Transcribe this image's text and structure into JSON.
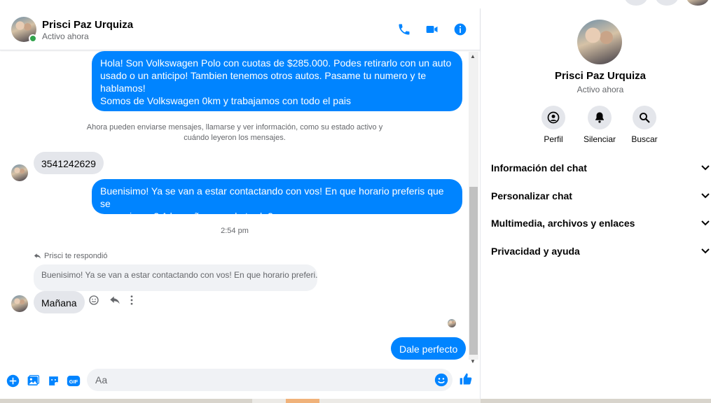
{
  "header": {
    "contact_name": "Prisci Paz Urquiza",
    "status": "Activo ahora",
    "icons": [
      "phone-icon",
      "video-camera-icon",
      "info-icon"
    ]
  },
  "messages": {
    "outgoing_1": "Hola! Son Volkswagen Polo con cuotas de $285.000. Podes retirarlo con un auto\nusado o un anticipo! Tambien tenemos otros autos. Pasame tu numero y te\nhablamos!\nSomos de Volkswagen 0km y trabajamos con todo el pais",
    "system_notice": "Ahora pueden enviarse mensajes, llamarse y ver información, como su estado activo y cuándo leyeron los mensajes.",
    "incoming_1": "3541242629",
    "outgoing_2": "Buenisimo! Ya se van a estar contactando con vos! En que horario preferis que se\ncomuniquen? A la mañana o a la tarde?",
    "timestamp": "2:54 pm",
    "reply_label": "Prisci te respondió",
    "quoted_text": "Buenisimo! Ya se van a estar contactando con vos! En que horario preferi...",
    "incoming_2": "Mañana",
    "outgoing_3": "Dale perfecto"
  },
  "composer": {
    "placeholder": "Aa",
    "icons": [
      "plus-icon",
      "image-icon",
      "sticker-icon",
      "gif-icon",
      "emoji-icon",
      "like-icon"
    ],
    "gif_label": "GIF"
  },
  "sidebar": {
    "name": "Prisci Paz Urquiza",
    "status": "Activo ahora",
    "actions": [
      {
        "label": "Perfil",
        "icon": "profile-icon"
      },
      {
        "label": "Silenciar",
        "icon": "bell-icon"
      },
      {
        "label": "Buscar",
        "icon": "search-icon"
      }
    ],
    "sections": [
      {
        "label": "Información del chat"
      },
      {
        "label": "Personalizar chat"
      },
      {
        "label": "Multimedia, archivos y enlaces"
      },
      {
        "label": "Privacidad y ayuda"
      }
    ]
  },
  "colors": {
    "accent": "#0084ff",
    "online": "#31a24c",
    "incoming_bubble": "#e4e6eb",
    "secondary_text": "#65676b"
  }
}
